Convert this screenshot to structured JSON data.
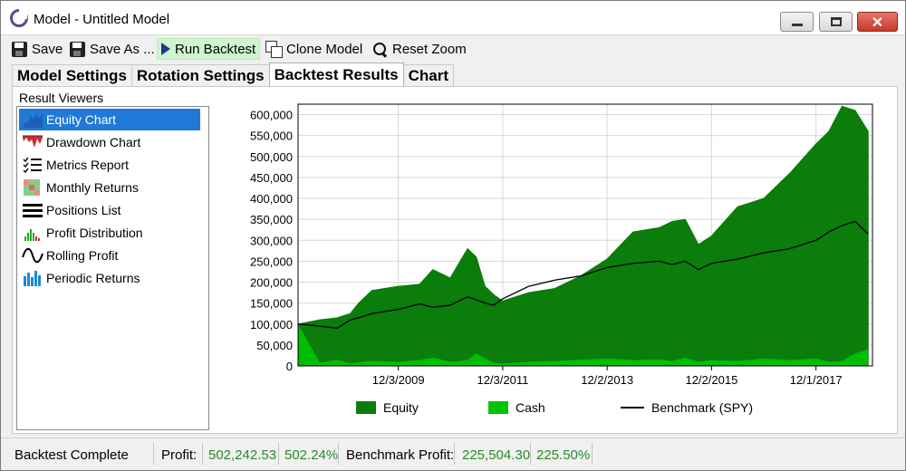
{
  "window": {
    "title": "Model - Untitled Model"
  },
  "toolbar": {
    "save_label": "Save",
    "save_as_label": "Save As ...",
    "run_backtest_label": "Run Backtest",
    "clone_model_label": "Clone Model",
    "reset_zoom_label": "Reset Zoom"
  },
  "tabs": [
    {
      "label": "Model Settings",
      "active": false
    },
    {
      "label": "Rotation Settings",
      "active": false
    },
    {
      "label": "Backtest Results",
      "active": true
    },
    {
      "label": "Chart",
      "active": false
    }
  ],
  "result_viewers": {
    "title": "Result Viewers",
    "items": [
      {
        "label": "Equity Chart",
        "icon": "equity-chart-icon",
        "selected": true
      },
      {
        "label": "Drawdown Chart",
        "icon": "drawdown-chart-icon",
        "selected": false
      },
      {
        "label": "Metrics Report",
        "icon": "checklist-icon",
        "selected": false
      },
      {
        "label": "Monthly Returns",
        "icon": "heatmap-grid-icon",
        "selected": false
      },
      {
        "label": "Positions List",
        "icon": "list-lines-icon",
        "selected": false
      },
      {
        "label": "Profit Distribution",
        "icon": "histogram-icon",
        "selected": false
      },
      {
        "label": "Rolling Profit",
        "icon": "wave-icon",
        "selected": false
      },
      {
        "label": "Periodic Returns",
        "icon": "bar-columns-icon",
        "selected": false
      }
    ]
  },
  "chart_data": {
    "type": "area",
    "title": "",
    "xlabel": "",
    "ylabel": "",
    "ylim": [
      0,
      625000
    ],
    "y_ticks": [
      "0",
      "50,000",
      "100,000",
      "150,000",
      "200,000",
      "250,000",
      "300,000",
      "350,000",
      "400,000",
      "450,000",
      "500,000",
      "550,000",
      "600,000"
    ],
    "x_tick_labels": [
      "12/3/2009",
      "12/3/2011",
      "12/2/2013",
      "12/2/2015",
      "12/1/2017"
    ],
    "x_range": [
      "2008-01-02",
      "2018-12-31"
    ],
    "grid": true,
    "legend_position": "bottom",
    "colors": {
      "equity": "#0a7d0a",
      "cash": "#00c400",
      "benchmark": "#000000"
    },
    "x": [
      "2008-01-02",
      "2008-06-01",
      "2008-10-01",
      "2009-01-01",
      "2009-03-01",
      "2009-06-01",
      "2009-12-01",
      "2010-05-01",
      "2010-08-01",
      "2010-12-01",
      "2011-04-01",
      "2011-06-01",
      "2011-08-01",
      "2011-10-01",
      "2011-12-01",
      "2012-06-01",
      "2012-12-01",
      "2013-06-01",
      "2013-12-01",
      "2014-06-01",
      "2014-12-01",
      "2015-03-01",
      "2015-06-01",
      "2015-09-01",
      "2015-12-01",
      "2016-06-01",
      "2016-12-01",
      "2017-06-01",
      "2017-12-01",
      "2018-03-01",
      "2018-06-01",
      "2018-09-01",
      "2018-12-01"
    ],
    "series": [
      {
        "name": "Equity",
        "values": [
          100000,
          110000,
          115000,
          125000,
          150000,
          180000,
          190000,
          195000,
          230000,
          210000,
          280000,
          260000,
          190000,
          170000,
          155000,
          175000,
          185000,
          215000,
          255000,
          320000,
          330000,
          345000,
          350000,
          290000,
          310000,
          380000,
          400000,
          460000,
          530000,
          560000,
          620000,
          610000,
          560000
        ]
      },
      {
        "name": "Cash",
        "values": [
          100000,
          8000,
          15000,
          6000,
          9000,
          12000,
          10000,
          14000,
          20000,
          10000,
          14000,
          30000,
          18000,
          8000,
          6000,
          10000,
          12000,
          15000,
          18000,
          14000,
          16000,
          12000,
          20000,
          10000,
          14000,
          12000,
          18000,
          14000,
          18000,
          10000,
          12000,
          30000,
          40000
        ]
      },
      {
        "name": "Benchmark (SPY)",
        "values": [
          100000,
          95000,
          90000,
          110000,
          115000,
          125000,
          135000,
          148000,
          140000,
          145000,
          165000,
          158000,
          150000,
          145000,
          160000,
          190000,
          205000,
          215000,
          235000,
          245000,
          250000,
          242000,
          250000,
          230000,
          245000,
          255000,
          270000,
          280000,
          300000,
          320000,
          335000,
          345000,
          315000
        ]
      }
    ]
  },
  "status": {
    "message": "Backtest Complete",
    "profit_label": "Profit:",
    "profit_value": "502,242.53",
    "profit_pct": "502.24%",
    "benchmark_label": "Benchmark Profit:",
    "benchmark_value": "225,504.30",
    "benchmark_pct": "225.50%"
  }
}
